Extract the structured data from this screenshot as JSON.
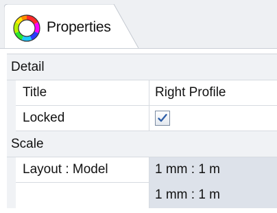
{
  "tab": {
    "label": "Properties",
    "icon": "color-wheel-icon"
  },
  "sections": {
    "detail": {
      "header": "Detail",
      "title_label": "Title",
      "title_value": "Right Profile",
      "locked_label": "Locked",
      "locked_checked": true
    },
    "scale": {
      "header": "Scale",
      "layout_label": "Layout : Model",
      "layout_value_1": "1 mm : 1 m",
      "layout_value_2": "1 mm : 1 m"
    }
  },
  "colors": {
    "tab_background": "#eef0f3",
    "section_background": "#f0f2f5",
    "shaded_value": "#dde2ea",
    "check_blue": "#2f5fa8"
  }
}
